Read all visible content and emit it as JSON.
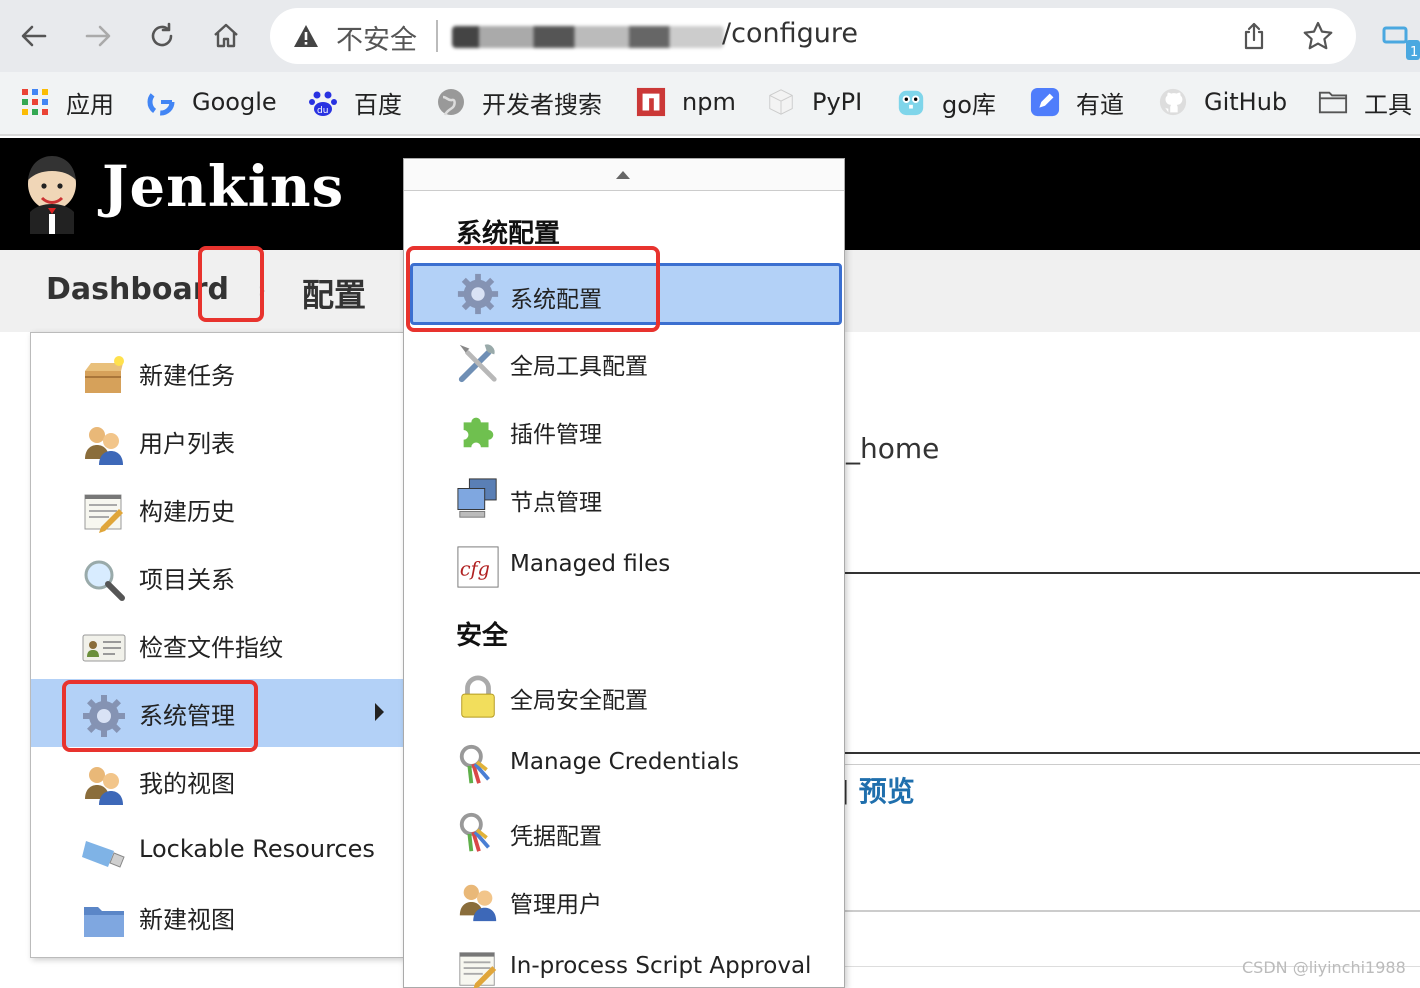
{
  "browser": {
    "address": {
      "security_label": "不安全",
      "path": "/configure"
    },
    "bookmarks": [
      {
        "label": "应用",
        "icon": "apps-grid-icon"
      },
      {
        "label": "Google",
        "icon": "google-icon"
      },
      {
        "label": "百度",
        "icon": "baidu-icon"
      },
      {
        "label": "开发者搜索",
        "icon": "globe-icon"
      },
      {
        "label": "npm",
        "icon": "npm-icon"
      },
      {
        "label": "PyPI",
        "icon": "pypi-cube-icon"
      },
      {
        "label": "go库",
        "icon": "gopher-icon"
      },
      {
        "label": "有道",
        "icon": "youdao-icon"
      },
      {
        "label": "GitHub",
        "icon": "github-icon"
      },
      {
        "label": "工具",
        "icon": "folder-icon"
      }
    ],
    "extension_badge": "1"
  },
  "jenkins": {
    "title": "Jenkins",
    "breadcrumb": {
      "dashboard": "Dashboard",
      "current": "配置"
    }
  },
  "background": {
    "home_text": "_home",
    "preview_bracket": "]",
    "preview_link": "预览"
  },
  "left_menu": {
    "items": [
      {
        "label": "新建任务",
        "icon": "new-item-box-icon"
      },
      {
        "label": "用户列表",
        "icon": "users-icon"
      },
      {
        "label": "构建历史",
        "icon": "notepad-icon"
      },
      {
        "label": "项目关系",
        "icon": "magnifier-icon"
      },
      {
        "label": "检查文件指纹",
        "icon": "fingerprint-card-icon"
      },
      {
        "label": "系统管理",
        "icon": "gear-icon"
      },
      {
        "label": "我的视图",
        "icon": "users-icon"
      },
      {
        "label": "Lockable Resources",
        "icon": "usb-drive-icon"
      },
      {
        "label": "新建视图",
        "icon": "folder-icon"
      }
    ],
    "active_index": 5
  },
  "submenu": {
    "section_system": "系统配置",
    "section_security": "安全",
    "system_items": [
      {
        "label": "系统配置",
        "icon": "gear-icon"
      },
      {
        "label": "全局工具配置",
        "icon": "tools-icon"
      },
      {
        "label": "插件管理",
        "icon": "puzzle-icon"
      },
      {
        "label": "节点管理",
        "icon": "computer-icon"
      },
      {
        "label": "Managed files",
        "icon": "cfg-file-icon"
      }
    ],
    "security_items": [
      {
        "label": "全局安全配置",
        "icon": "lock-icon"
      },
      {
        "label": "Manage Credentials",
        "icon": "keys-icon"
      },
      {
        "label": "凭据配置",
        "icon": "keys-icon"
      },
      {
        "label": "管理用户",
        "icon": "users-icon"
      },
      {
        "label": "In-process Script Approval",
        "icon": "notepad-icon"
      }
    ]
  },
  "watermark": "CSDN @liyinchi1988",
  "colors": {
    "header_bg": "#000000",
    "active_item_bg": "#b3d1f7",
    "active_item_border": "#3b6fd0",
    "annotation_red": "#e8332e",
    "link_blue": "#1f6fad"
  }
}
